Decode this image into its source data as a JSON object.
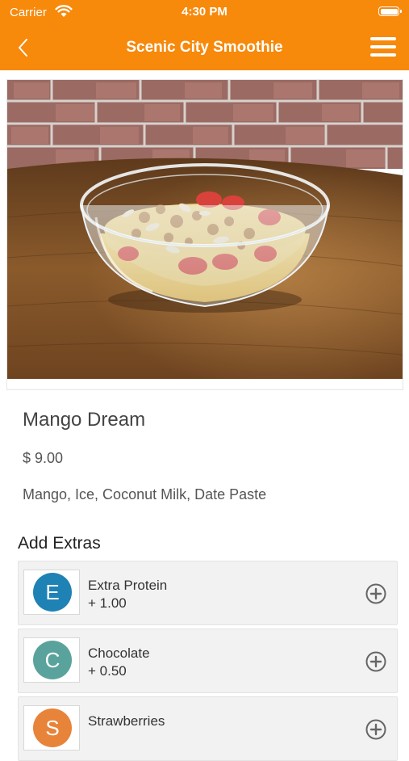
{
  "status_bar": {
    "carrier": "Carrier",
    "time": "4:30 PM"
  },
  "nav": {
    "title": "Scenic City Smoothie",
    "back_icon": "chevron-left-icon",
    "menu_icon": "hamburger-menu-icon"
  },
  "product": {
    "name": "Mango Dream",
    "price": "$ 9.00",
    "description": "Mango, Ice, Coconut Milk, Date Paste"
  },
  "extras": {
    "heading": "Add Extras",
    "items": [
      {
        "initial": "E",
        "name": "Extra Protein",
        "price": "+ 1.00",
        "color": "#1f82b5"
      },
      {
        "initial": "C",
        "name": "Chocolate",
        "price": "+ 0.50",
        "color": "#5aa39c"
      },
      {
        "initial": "S",
        "name": "Strawberries",
        "price": "",
        "color": "#e8833a"
      }
    ]
  },
  "colors": {
    "brand_orange": "#f7890b",
    "card_background": "#f2f2f2"
  }
}
